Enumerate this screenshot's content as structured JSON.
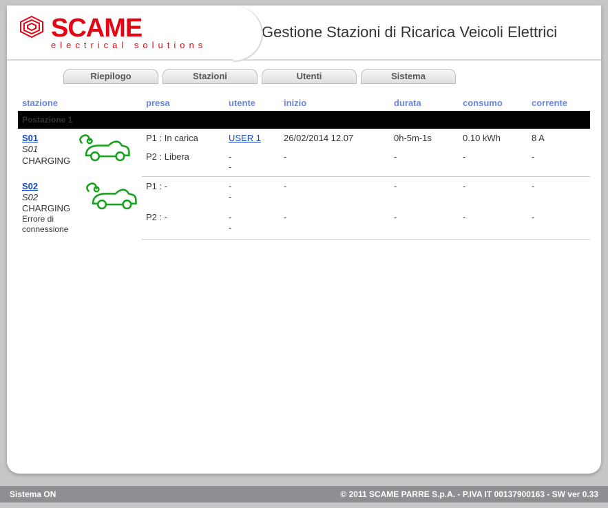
{
  "header": {
    "brand_main": "SCAME",
    "brand_sub": "electrical solutions",
    "app_title": "Gestione Stazioni di Ricarica Veicoli Elettrici"
  },
  "tabs": [
    "Riepilogo",
    "Stazioni",
    "Utenti",
    "Sistema"
  ],
  "columns": {
    "stazione": "stazione",
    "presa": "presa",
    "utente": "utente",
    "inizio": "inizio",
    "durata": "durata",
    "consumo": "consumo",
    "corrente": "corrente"
  },
  "group_label": "Postazione 1",
  "stations": [
    {
      "id": "S01",
      "name": "S01",
      "status": "CHARGING",
      "error": "",
      "sockets": [
        {
          "presa": "P1 : In carica",
          "utente": "USER 1",
          "utente_link": true,
          "inizio": "26/02/2014 12.07",
          "durata": "0h-5m-1s",
          "consumo": "0.10 kWh",
          "corrente": "8 A"
        },
        {
          "presa": "P2 : Libera",
          "utente": "-",
          "utente_link": false,
          "inizio": "-",
          "durata": "-",
          "consumo": "-",
          "corrente": "-",
          "utente_prefix": "-"
        }
      ]
    },
    {
      "id": "S02",
      "name": "S02",
      "status": "CHARGING",
      "error": "Errore di connessione",
      "sockets": [
        {
          "presa": "P1 : -",
          "utente": "-",
          "utente_link": false,
          "inizio": "-",
          "durata": "-",
          "consumo": "-",
          "corrente": "-",
          "utente_prefix": "-"
        },
        {
          "presa": "P2 : -",
          "utente": "-",
          "utente_link": false,
          "inizio": "-",
          "durata": "-",
          "consumo": "-",
          "corrente": "-",
          "utente_prefix": "-"
        }
      ]
    }
  ],
  "footer": {
    "system_label": "Sistema",
    "system_state": "ON",
    "copyright": "© 2011 SCAME PARRE S.p.A. - P.IVA IT 00137900163 - SW ver 0.33"
  }
}
